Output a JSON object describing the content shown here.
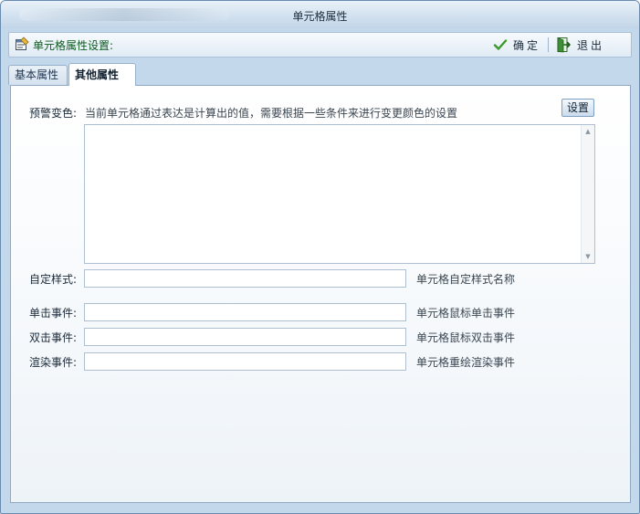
{
  "window": {
    "title": "单元格属性"
  },
  "toolbar": {
    "title": "单元格属性设置:",
    "ok_label": "确定",
    "exit_label": "退出"
  },
  "tabs": [
    {
      "label": "基本属性",
      "active": false
    },
    {
      "label": "其他属性",
      "active": true
    }
  ],
  "warning": {
    "label": "预警变色:",
    "description": "当前单元格通过表达是计算出的值，需要根据一些条件来进行变更颜色的设置",
    "button_label": "设置",
    "value": ""
  },
  "fields": [
    {
      "label": "自定样式:",
      "value": "",
      "hint": "单元格自定样式名称"
    },
    {
      "label": "单击事件:",
      "value": "",
      "hint": "单元格鼠标单击事件"
    },
    {
      "label": "双击事件:",
      "value": "",
      "hint": "单元格鼠标双击事件"
    },
    {
      "label": "渲染事件:",
      "value": "",
      "hint": "单元格重绘渲染事件"
    }
  ],
  "colors": {
    "accent_green": "#0d5a1e",
    "frame_blue": "#c4d8ec",
    "border_blue": "#8fa9c4"
  },
  "icons": {
    "toolbar_icon": "properties-icon",
    "ok_icon": "checkmark-icon",
    "exit_icon": "exit-door-icon"
  }
}
